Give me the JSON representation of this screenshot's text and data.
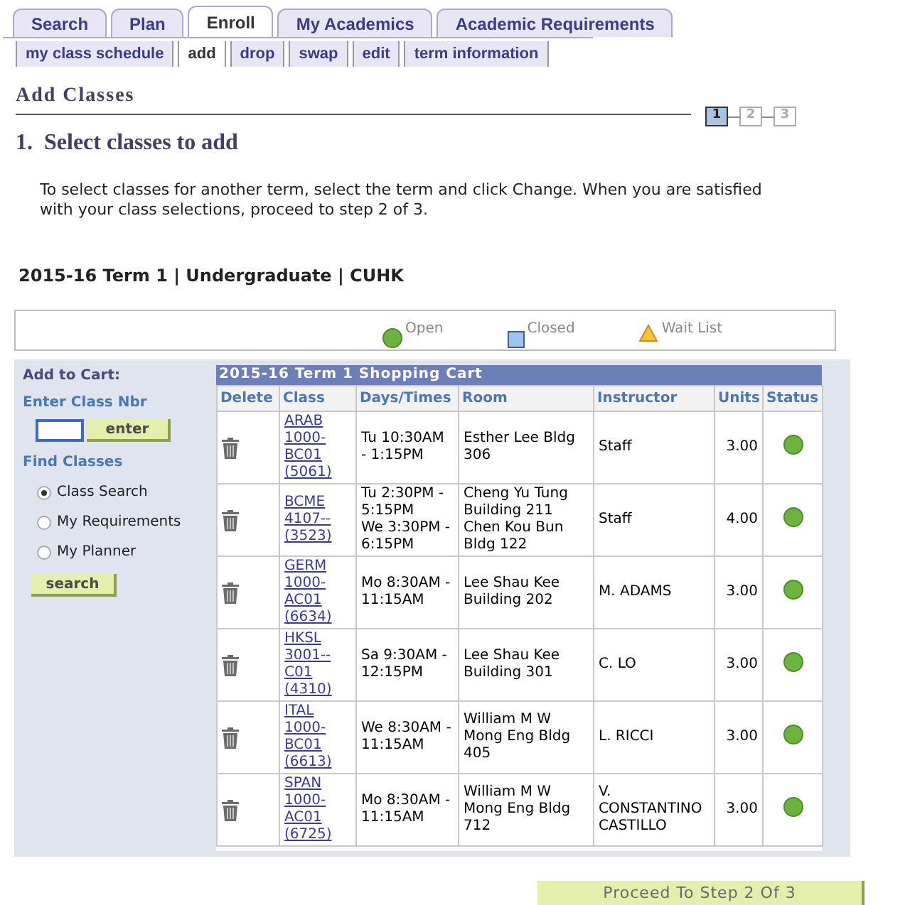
{
  "tabs": [
    {
      "label": "Search",
      "selected": false
    },
    {
      "label": "Plan",
      "selected": false
    },
    {
      "label": "Enroll",
      "selected": true
    },
    {
      "label": "My Academics",
      "selected": false
    },
    {
      "label": "Academic Requirements",
      "selected": false
    }
  ],
  "subtabs": [
    {
      "label": "my class schedule",
      "selected": false
    },
    {
      "label": "add",
      "selected": true
    },
    {
      "label": "drop",
      "selected": false
    },
    {
      "label": "swap",
      "selected": false
    },
    {
      "label": "edit",
      "selected": false
    },
    {
      "label": "term information",
      "selected": false
    }
  ],
  "page_title": "Add Classes",
  "steps": [
    {
      "label": "1",
      "selected": true
    },
    {
      "label": "2",
      "selected": false
    },
    {
      "label": "3",
      "selected": false
    }
  ],
  "step_heading": "1.  Select classes to add",
  "instructions": "To select classes for another term, select the term and click Change.  When you are satisfied with your class selections, proceed to step 2 of 3.",
  "term": "2015-16 Term 1 | Undergraduate | CUHK",
  "legend": [
    {
      "kind": "open",
      "label": "Open"
    },
    {
      "kind": "closed",
      "label": "Closed"
    },
    {
      "kind": "waitlist",
      "label": "Wait List"
    }
  ],
  "add_to_cart": {
    "title": "Add to Cart:",
    "class_nbr_label": "Enter Class Nbr",
    "enter_button": "enter",
    "find_title": "Find Classes",
    "options": [
      {
        "label": "Class Search",
        "selected": true
      },
      {
        "label": "My Requirements",
        "selected": false
      },
      {
        "label": "My Planner",
        "selected": false
      }
    ],
    "search_button": "search"
  },
  "cart": {
    "title": "2015-16 Term 1 Shopping Cart",
    "columns": [
      "Delete",
      "Class",
      "Days/Times",
      "Room",
      "Instructor",
      "Units",
      "Status"
    ],
    "rows": [
      {
        "class": "ARAB 1000-BC01 (5061)",
        "days": [
          "Tu 10:30AM - 1:15PM"
        ],
        "room": [
          "Esther Lee Bldg 306"
        ],
        "instructor": "Staff",
        "units": "3.00",
        "kind": "open"
      },
      {
        "class": "BCME 4107-- (3523)",
        "days": [
          "Tu 2:30PM - 5:15PM",
          "We 3:30PM - 6:15PM"
        ],
        "room": [
          "Cheng Yu Tung Building 211",
          "Chen Kou Bun Bldg 122"
        ],
        "instructor": "Staff",
        "units": "4.00",
        "kind": "open"
      },
      {
        "class": "GERM 1000-AC01 (6634)",
        "days": [
          "Mo 8:30AM - 11:15AM"
        ],
        "room": [
          "Lee Shau Kee Building 202"
        ],
        "instructor": "M. ADAMS",
        "units": "3.00",
        "kind": "open"
      },
      {
        "class": "HKSL 3001-- C01 (4310)",
        "days": [
          "Sa 9:30AM - 12:15PM"
        ],
        "room": [
          "Lee Shau Kee Building 301"
        ],
        "instructor": "C. LO",
        "units": "3.00",
        "kind": "open"
      },
      {
        "class": "ITAL 1000-BC01 (6613)",
        "days": [
          "We 8:30AM - 11:15AM"
        ],
        "room": [
          "William M W Mong Eng Bldg 405"
        ],
        "instructor": "L. RICCI",
        "units": "3.00",
        "kind": "open"
      },
      {
        "class": "SPAN 1000-AC01 (6725)",
        "days": [
          "Mo 8:30AM - 11:15AM"
        ],
        "room": [
          "William M W Mong Eng Bldg 712"
        ],
        "instructor": "V. CONSTANTINO CASTILLO",
        "units": "3.00",
        "kind": "open"
      }
    ]
  },
  "proceed_button": "Proceed To Step 2 Of 3"
}
